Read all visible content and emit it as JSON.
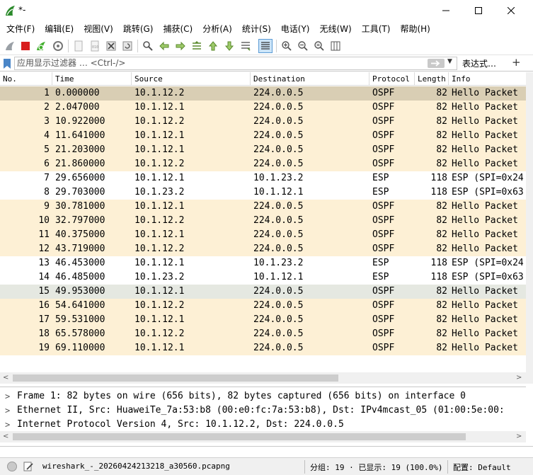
{
  "window": {
    "title": "*-"
  },
  "menu": [
    "文件(F)",
    "编辑(E)",
    "视图(V)",
    "跳转(G)",
    "捕获(C)",
    "分析(A)",
    "统计(S)",
    "电话(Y)",
    "无线(W)",
    "工具(T)",
    "帮助(H)"
  ],
  "filter": {
    "placeholder": "应用显示过滤器 … <Ctrl-/>",
    "expression_label": "表达式…",
    "add_label": "+"
  },
  "packet_list": {
    "columns": [
      "No.",
      "Time",
      "Source",
      "Destination",
      "Protocol",
      "Length",
      "Info"
    ],
    "rows": [
      {
        "no": "1",
        "time": "0.000000",
        "src": "10.1.12.2",
        "dst": "224.0.0.5",
        "proto": "OSPF",
        "len": "82",
        "info": "Hello Packet",
        "state": "selected"
      },
      {
        "no": "2",
        "time": "2.047000",
        "src": "10.1.12.1",
        "dst": "224.0.0.5",
        "proto": "OSPF",
        "len": "82",
        "info": "Hello Packet",
        "state": "ospf"
      },
      {
        "no": "3",
        "time": "10.922000",
        "src": "10.1.12.2",
        "dst": "224.0.0.5",
        "proto": "OSPF",
        "len": "82",
        "info": "Hello Packet",
        "state": "ospf"
      },
      {
        "no": "4",
        "time": "11.641000",
        "src": "10.1.12.1",
        "dst": "224.0.0.5",
        "proto": "OSPF",
        "len": "82",
        "info": "Hello Packet",
        "state": "ospf"
      },
      {
        "no": "5",
        "time": "21.203000",
        "src": "10.1.12.1",
        "dst": "224.0.0.5",
        "proto": "OSPF",
        "len": "82",
        "info": "Hello Packet",
        "state": "ospf"
      },
      {
        "no": "6",
        "time": "21.860000",
        "src": "10.1.12.2",
        "dst": "224.0.0.5",
        "proto": "OSPF",
        "len": "82",
        "info": "Hello Packet",
        "state": "ospf"
      },
      {
        "no": "7",
        "time": "29.656000",
        "src": "10.1.12.1",
        "dst": "10.1.23.2",
        "proto": "ESP",
        "len": "118",
        "info": "ESP (SPI=0x24",
        "state": "esp"
      },
      {
        "no": "8",
        "time": "29.703000",
        "src": "10.1.23.2",
        "dst": "10.1.12.1",
        "proto": "ESP",
        "len": "118",
        "info": "ESP (SPI=0x63",
        "state": "esp"
      },
      {
        "no": "9",
        "time": "30.781000",
        "src": "10.1.12.1",
        "dst": "224.0.0.5",
        "proto": "OSPF",
        "len": "82",
        "info": "Hello Packet",
        "state": "ospf"
      },
      {
        "no": "10",
        "time": "32.797000",
        "src": "10.1.12.2",
        "dst": "224.0.0.5",
        "proto": "OSPF",
        "len": "82",
        "info": "Hello Packet",
        "state": "ospf"
      },
      {
        "no": "11",
        "time": "40.375000",
        "src": "10.1.12.1",
        "dst": "224.0.0.5",
        "proto": "OSPF",
        "len": "82",
        "info": "Hello Packet",
        "state": "ospf"
      },
      {
        "no": "12",
        "time": "43.719000",
        "src": "10.1.12.2",
        "dst": "224.0.0.5",
        "proto": "OSPF",
        "len": "82",
        "info": "Hello Packet",
        "state": "ospf"
      },
      {
        "no": "13",
        "time": "46.453000",
        "src": "10.1.12.1",
        "dst": "10.1.23.2",
        "proto": "ESP",
        "len": "118",
        "info": "ESP (SPI=0x24",
        "state": "esp"
      },
      {
        "no": "14",
        "time": "46.485000",
        "src": "10.1.23.2",
        "dst": "10.1.12.1",
        "proto": "ESP",
        "len": "118",
        "info": "ESP (SPI=0x63",
        "state": "esp"
      },
      {
        "no": "15",
        "time": "49.953000",
        "src": "10.1.12.1",
        "dst": "224.0.0.5",
        "proto": "OSPF",
        "len": "82",
        "info": "Hello Packet",
        "state": "hover"
      },
      {
        "no": "16",
        "time": "54.641000",
        "src": "10.1.12.2",
        "dst": "224.0.0.5",
        "proto": "OSPF",
        "len": "82",
        "info": "Hello Packet",
        "state": "ospf"
      },
      {
        "no": "17",
        "time": "59.531000",
        "src": "10.1.12.1",
        "dst": "224.0.0.5",
        "proto": "OSPF",
        "len": "82",
        "info": "Hello Packet",
        "state": "ospf"
      },
      {
        "no": "18",
        "time": "65.578000",
        "src": "10.1.12.2",
        "dst": "224.0.0.5",
        "proto": "OSPF",
        "len": "82",
        "info": "Hello Packet",
        "state": "ospf"
      },
      {
        "no": "19",
        "time": "69.110000",
        "src": "10.1.12.1",
        "dst": "224.0.0.5",
        "proto": "OSPF",
        "len": "82",
        "info": "Hello Packet",
        "state": "ospf"
      }
    ]
  },
  "row_colors": {
    "ospf": "#fdf0d5",
    "esp": "#ffffff",
    "selected": "#d9ceb4",
    "hover": "#e5e8e1"
  },
  "details": [
    "Frame 1: 82 bytes on wire (656 bits), 82 bytes captured (656 bits) on interface 0",
    "Ethernet II, Src: HuaweiTe_7a:53:b8 (00:e0:fc:7a:53:b8), Dst: IPv4mcast_05 (01:00:5e:00:",
    "Internet Protocol Version 4, Src: 10.1.12.2, Dst: 224.0.0.5"
  ],
  "status": {
    "file": "wireshark_-_20260424213218_a30560.pcapng",
    "stats": "分组: 19 · 已显示: 19 (100.0%)",
    "profile": "配置: Default"
  }
}
